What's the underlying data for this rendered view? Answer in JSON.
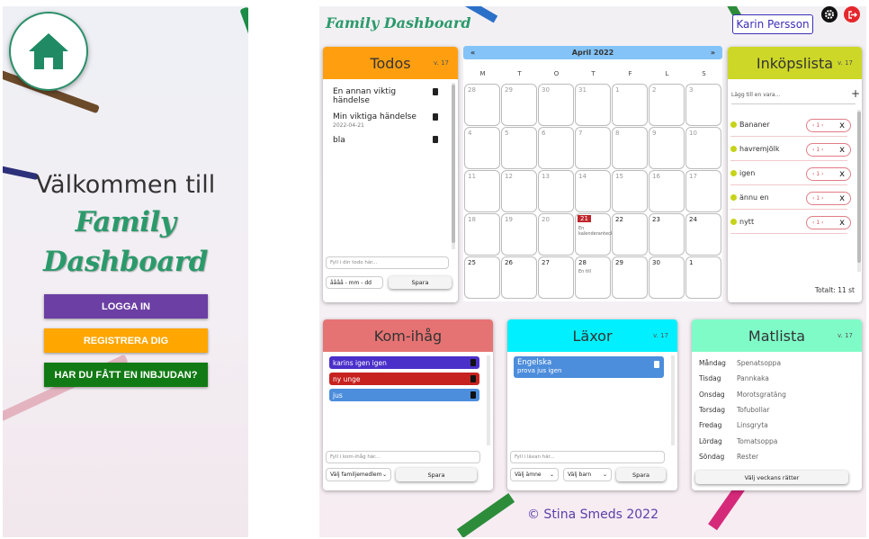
{
  "colors": {
    "brand_green": "#2b9a6b",
    "todos_header": "#ff9f10",
    "calendar_header": "#84c3f7",
    "inkop_header": "#cdd727",
    "kom_header": "#e67373",
    "laxor_header": "#00f0ff",
    "matlista_header": "#7ffbc8",
    "login_button": "#6b3fa3",
    "register_button": "#ffa600",
    "invite_button": "#127a14",
    "today_marker": "#c0252b"
  },
  "login": {
    "home_icon": "home-icon",
    "welcome": "Välkommen till",
    "brand_line1": "Family",
    "brand_line2": "Dashboard",
    "login_button": "LOGGA IN",
    "register_button": "REGISTRERA DIG",
    "invite_button": "HAR DU FÅTT EN INBJUDAN?"
  },
  "dashboard": {
    "title": "Family Dashboard",
    "user_name": "Karin Persson",
    "settings_icon": "gear-icon",
    "logout_icon": "logout-icon",
    "footer": "© Stina Smeds 2022"
  },
  "todos": {
    "title": "Todos",
    "week": "v. 17",
    "items": [
      {
        "text": "En annan viktig händelse",
        "date": ""
      },
      {
        "text": "Min viktiga händelse",
        "date": "2022-04-21"
      },
      {
        "text": "bla",
        "date": ""
      }
    ],
    "input_placeholder": "Fyll i din todo här...",
    "date_placeholder": "åååå - mm - dd",
    "save_label": "Spara"
  },
  "calendar": {
    "prev": "«",
    "next": "»",
    "month": "April 2022",
    "weekdays": [
      "M",
      "T",
      "O",
      "T",
      "F",
      "L",
      "S"
    ],
    "days": [
      {
        "n": "28",
        "cur": false
      },
      {
        "n": "29",
        "cur": false
      },
      {
        "n": "30",
        "cur": false
      },
      {
        "n": "31",
        "cur": false
      },
      {
        "n": "1",
        "cur": false
      },
      {
        "n": "2",
        "cur": false
      },
      {
        "n": "3",
        "cur": false
      },
      {
        "n": "4",
        "cur": false
      },
      {
        "n": "5",
        "cur": false
      },
      {
        "n": "6",
        "cur": false
      },
      {
        "n": "7",
        "cur": false
      },
      {
        "n": "8",
        "cur": false
      },
      {
        "n": "9",
        "cur": false
      },
      {
        "n": "10",
        "cur": false
      },
      {
        "n": "11",
        "cur": false
      },
      {
        "n": "12",
        "cur": false
      },
      {
        "n": "13",
        "cur": false
      },
      {
        "n": "14",
        "cur": false
      },
      {
        "n": "15",
        "cur": false
      },
      {
        "n": "16",
        "cur": false
      },
      {
        "n": "17",
        "cur": false
      },
      {
        "n": "18",
        "cur": false
      },
      {
        "n": "19",
        "cur": false
      },
      {
        "n": "20",
        "cur": false
      },
      {
        "n": "21",
        "cur": true,
        "today": true,
        "event": "En kalenderanteckning"
      },
      {
        "n": "22",
        "cur": true
      },
      {
        "n": "23",
        "cur": true
      },
      {
        "n": "24",
        "cur": true
      },
      {
        "n": "25",
        "cur": true
      },
      {
        "n": "26",
        "cur": true
      },
      {
        "n": "27",
        "cur": true
      },
      {
        "n": "28",
        "cur": true,
        "event": "En till"
      },
      {
        "n": "29",
        "cur": true
      },
      {
        "n": "30",
        "cur": true
      },
      {
        "n": "1",
        "cur": true
      }
    ]
  },
  "inkop": {
    "title": "Inköpslista",
    "week": "v. 17",
    "input_placeholder": "Lägg till en vara...",
    "add_label": "+",
    "items": [
      {
        "name": "Bananer",
        "qty": "1"
      },
      {
        "name": "havremjölk",
        "qty": "1"
      },
      {
        "name": "igen",
        "qty": "1"
      },
      {
        "name": "ännu en",
        "qty": "1"
      },
      {
        "name": "nytt",
        "qty": "1"
      }
    ],
    "stepper_minus": "‹",
    "stepper_plus": "›",
    "remove": "x",
    "total": "Totalt: 11 st"
  },
  "kom": {
    "title": "Kom-ihåg",
    "items": [
      {
        "text": "karins igen igen",
        "color": "#4b2fc9"
      },
      {
        "text": "ny unge",
        "color": "#c6221f"
      },
      {
        "text": "jus",
        "color": "#4c8ddc"
      }
    ],
    "input_placeholder": "Fyll i kom-ihåg här...",
    "member_select": "Välj familjemedlem",
    "save_label": "Spara"
  },
  "laxor": {
    "title": "Läxor",
    "week": "v. 17",
    "items": [
      {
        "subject": "Engelska",
        "note": "prova jus igen"
      }
    ],
    "input_placeholder": "Fyll i läxan här...",
    "subject_select": "Välj ämne",
    "child_select": "Välj barn",
    "save_label": "Spara"
  },
  "matlista": {
    "title": "Matlista",
    "week": "v. 17",
    "days": [
      {
        "day": "Måndag",
        "food": "Spenatsoppa"
      },
      {
        "day": "Tisdag",
        "food": "Pannkaka"
      },
      {
        "day": "Onsdag",
        "food": "Morotsgratäng"
      },
      {
        "day": "Torsdag",
        "food": "Tofubollar"
      },
      {
        "day": "Fredag",
        "food": "Linsgryta"
      },
      {
        "day": "Lördag",
        "food": "Tomatsoppa"
      },
      {
        "day": "Söndag",
        "food": "Rester"
      }
    ],
    "choose_label": "Välj veckans rätter"
  }
}
